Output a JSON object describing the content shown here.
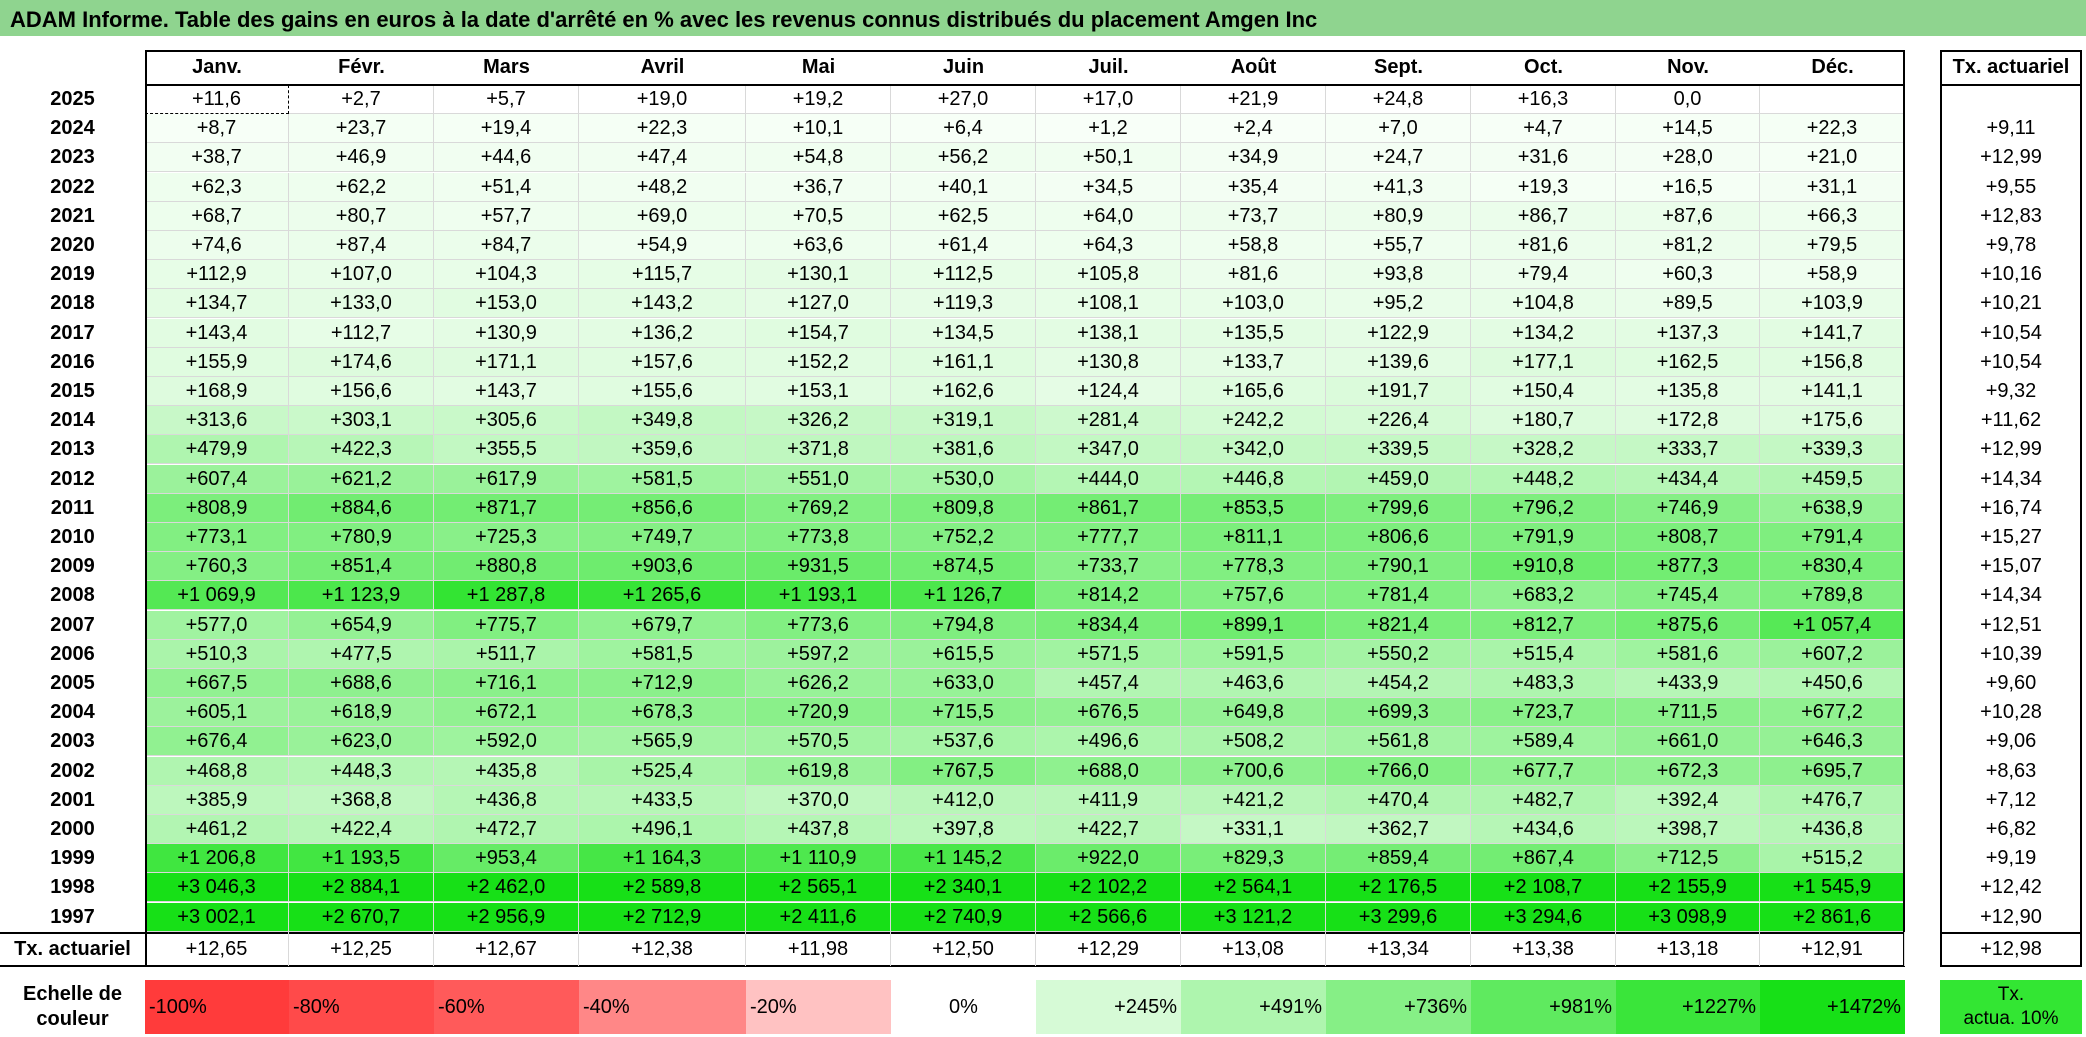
{
  "title": "ADAM Informe. Table des gains en euros à la date d'arrêté en % avec les revenus connus distribués du placement Amgen Inc",
  "months": [
    "Janv.",
    "Févr.",
    "Mars",
    "Avril",
    "Mai",
    "Juin",
    "Juil.",
    "Août",
    "Sept.",
    "Oct.",
    "Nov.",
    "Déc."
  ],
  "actuarial_header": "Tx. actuariel",
  "rows": [
    {
      "year": "2025",
      "values": [
        "+11,6",
        "+2,7",
        "+5,7",
        "+19,0",
        "+19,2",
        "+27,0",
        "+17,0",
        "+21,9",
        "+24,8",
        "+16,3",
        "0,0",
        ""
      ],
      "act": ""
    },
    {
      "year": "2024",
      "values": [
        "+8,7",
        "+23,7",
        "+19,4",
        "+22,3",
        "+10,1",
        "+6,4",
        "+1,2",
        "+2,4",
        "+7,0",
        "+4,7",
        "+14,5",
        "+22,3"
      ],
      "act": "+9,11"
    },
    {
      "year": "2023",
      "values": [
        "+38,7",
        "+46,9",
        "+44,6",
        "+47,4",
        "+54,8",
        "+56,2",
        "+50,1",
        "+34,9",
        "+24,7",
        "+31,6",
        "+28,0",
        "+21,0"
      ],
      "act": "+12,99"
    },
    {
      "year": "2022",
      "values": [
        "+62,3",
        "+62,2",
        "+51,4",
        "+48,2",
        "+36,7",
        "+40,1",
        "+34,5",
        "+35,4",
        "+41,3",
        "+19,3",
        "+16,5",
        "+31,1"
      ],
      "act": "+9,55"
    },
    {
      "year": "2021",
      "values": [
        "+68,7",
        "+80,7",
        "+57,7",
        "+69,0",
        "+70,5",
        "+62,5",
        "+64,0",
        "+73,7",
        "+80,9",
        "+86,7",
        "+87,6",
        "+66,3"
      ],
      "act": "+12,83"
    },
    {
      "year": "2020",
      "values": [
        "+74,6",
        "+87,4",
        "+84,7",
        "+54,9",
        "+63,6",
        "+61,4",
        "+64,3",
        "+58,8",
        "+55,7",
        "+81,6",
        "+81,2",
        "+79,5"
      ],
      "act": "+9,78"
    },
    {
      "year": "2019",
      "values": [
        "+112,9",
        "+107,0",
        "+104,3",
        "+115,7",
        "+130,1",
        "+112,5",
        "+105,8",
        "+81,6",
        "+93,8",
        "+79,4",
        "+60,3",
        "+58,9"
      ],
      "act": "+10,16"
    },
    {
      "year": "2018",
      "values": [
        "+134,7",
        "+133,0",
        "+153,0",
        "+143,2",
        "+127,0",
        "+119,3",
        "+108,1",
        "+103,0",
        "+95,2",
        "+104,8",
        "+89,5",
        "+103,9"
      ],
      "act": "+10,21"
    },
    {
      "year": "2017",
      "values": [
        "+143,4",
        "+112,7",
        "+130,9",
        "+136,2",
        "+154,7",
        "+134,5",
        "+138,1",
        "+135,5",
        "+122,9",
        "+134,2",
        "+137,3",
        "+141,7"
      ],
      "act": "+10,54"
    },
    {
      "year": "2016",
      "values": [
        "+155,9",
        "+174,6",
        "+171,1",
        "+157,6",
        "+152,2",
        "+161,1",
        "+130,8",
        "+133,7",
        "+139,6",
        "+177,1",
        "+162,5",
        "+156,8"
      ],
      "act": "+10,54"
    },
    {
      "year": "2015",
      "values": [
        "+168,9",
        "+156,6",
        "+143,7",
        "+155,6",
        "+153,1",
        "+162,6",
        "+124,4",
        "+165,6",
        "+191,7",
        "+150,4",
        "+135,8",
        "+141,1"
      ],
      "act": "+9,32"
    },
    {
      "year": "2014",
      "values": [
        "+313,6",
        "+303,1",
        "+305,6",
        "+349,8",
        "+326,2",
        "+319,1",
        "+281,4",
        "+242,2",
        "+226,4",
        "+180,7",
        "+172,8",
        "+175,6"
      ],
      "act": "+11,62"
    },
    {
      "year": "2013",
      "values": [
        "+479,9",
        "+422,3",
        "+355,5",
        "+359,6",
        "+371,8",
        "+381,6",
        "+347,0",
        "+342,0",
        "+339,5",
        "+328,2",
        "+333,7",
        "+339,3"
      ],
      "act": "+12,99"
    },
    {
      "year": "2012",
      "values": [
        "+607,4",
        "+621,2",
        "+617,9",
        "+581,5",
        "+551,0",
        "+530,0",
        "+444,0",
        "+446,8",
        "+459,0",
        "+448,2",
        "+434,4",
        "+459,5"
      ],
      "act": "+14,34"
    },
    {
      "year": "2011",
      "values": [
        "+808,9",
        "+884,6",
        "+871,7",
        "+856,6",
        "+769,2",
        "+809,8",
        "+861,7",
        "+853,5",
        "+799,6",
        "+796,2",
        "+746,9",
        "+638,9"
      ],
      "act": "+16,74"
    },
    {
      "year": "2010",
      "values": [
        "+773,1",
        "+780,9",
        "+725,3",
        "+749,7",
        "+773,8",
        "+752,2",
        "+777,7",
        "+811,1",
        "+806,6",
        "+791,9",
        "+808,7",
        "+791,4"
      ],
      "act": "+15,27"
    },
    {
      "year": "2009",
      "values": [
        "+760,3",
        "+851,4",
        "+880,8",
        "+903,6",
        "+931,5",
        "+874,5",
        "+733,7",
        "+778,3",
        "+790,1",
        "+910,8",
        "+877,3",
        "+830,4"
      ],
      "act": "+15,07"
    },
    {
      "year": "2008",
      "values": [
        "+1 069,9",
        "+1 123,9",
        "+1 287,8",
        "+1 265,6",
        "+1 193,1",
        "+1 126,7",
        "+814,2",
        "+757,6",
        "+781,4",
        "+683,2",
        "+745,4",
        "+789,8"
      ],
      "act": "+14,34"
    },
    {
      "year": "2007",
      "values": [
        "+577,0",
        "+654,9",
        "+775,7",
        "+679,7",
        "+773,6",
        "+794,8",
        "+834,4",
        "+899,1",
        "+821,4",
        "+812,7",
        "+875,6",
        "+1 057,4"
      ],
      "act": "+12,51"
    },
    {
      "year": "2006",
      "values": [
        "+510,3",
        "+477,5",
        "+511,7",
        "+581,5",
        "+597,2",
        "+615,5",
        "+571,5",
        "+591,5",
        "+550,2",
        "+515,4",
        "+581,6",
        "+607,2"
      ],
      "act": "+10,39"
    },
    {
      "year": "2005",
      "values": [
        "+667,5",
        "+688,6",
        "+716,1",
        "+712,9",
        "+626,2",
        "+633,0",
        "+457,4",
        "+463,6",
        "+454,2",
        "+483,3",
        "+433,9",
        "+450,6"
      ],
      "act": "+9,60"
    },
    {
      "year": "2004",
      "values": [
        "+605,1",
        "+618,9",
        "+672,1",
        "+678,3",
        "+720,9",
        "+715,5",
        "+676,5",
        "+649,8",
        "+699,3",
        "+723,7",
        "+711,5",
        "+677,2"
      ],
      "act": "+10,28"
    },
    {
      "year": "2003",
      "values": [
        "+676,4",
        "+623,0",
        "+592,0",
        "+565,9",
        "+570,5",
        "+537,6",
        "+496,6",
        "+508,2",
        "+561,8",
        "+589,4",
        "+661,0",
        "+646,3"
      ],
      "act": "+9,06"
    },
    {
      "year": "2002",
      "values": [
        "+468,8",
        "+448,3",
        "+435,8",
        "+525,4",
        "+619,8",
        "+767,5",
        "+688,0",
        "+700,6",
        "+766,0",
        "+677,7",
        "+672,3",
        "+695,7"
      ],
      "act": "+8,63"
    },
    {
      "year": "2001",
      "values": [
        "+385,9",
        "+368,8",
        "+436,8",
        "+433,5",
        "+370,0",
        "+412,0",
        "+411,9",
        "+421,2",
        "+470,4",
        "+482,7",
        "+392,4",
        "+476,7"
      ],
      "act": "+7,12"
    },
    {
      "year": "2000",
      "values": [
        "+461,2",
        "+422,4",
        "+472,7",
        "+496,1",
        "+437,8",
        "+397,8",
        "+422,7",
        "+331,1",
        "+362,7",
        "+434,6",
        "+398,7",
        "+436,8"
      ],
      "act": "+6,82"
    },
    {
      "year": "1999",
      "values": [
        "+1 206,8",
        "+1 193,5",
        "+953,4",
        "+1 164,3",
        "+1 110,9",
        "+1 145,2",
        "+922,0",
        "+829,3",
        "+859,4",
        "+867,4",
        "+712,5",
        "+515,2"
      ],
      "act": "+9,19"
    },
    {
      "year": "1998",
      "values": [
        "+3 046,3",
        "+2 884,1",
        "+2 462,0",
        "+2 589,8",
        "+2 565,1",
        "+2 340,1",
        "+2 102,2",
        "+2 564,1",
        "+2 176,5",
        "+2 108,7",
        "+2 155,9",
        "+1 545,9"
      ],
      "act": "+12,42"
    },
    {
      "year": "1997",
      "values": [
        "+3 002,1",
        "+2 670,7",
        "+2 956,9",
        "+2 712,9",
        "+2 411,6",
        "+2 740,9",
        "+2 566,6",
        "+3 121,2",
        "+3 299,6",
        "+3 294,6",
        "+3 098,9",
        "+2 861,6"
      ],
      "act": "+12,90"
    }
  ],
  "footer": {
    "label": "Tx. actuariel",
    "values": [
      "+12,65",
      "+12,25",
      "+12,67",
      "+12,38",
      "+11,98",
      "+12,50",
      "+12,29",
      "+13,08",
      "+13,34",
      "+13,38",
      "+13,18",
      "+12,91"
    ],
    "total": "+12,98"
  },
  "scale": {
    "label_line1": "Echelle de",
    "label_line2": "couleur",
    "items": [
      {
        "label": "-100%",
        "color": "#ff3b3b",
        "align": "left"
      },
      {
        "label": "-80%",
        "color": "#ff4a4a",
        "align": "left"
      },
      {
        "label": "-60%",
        "color": "#ff5a5a",
        "align": "left"
      },
      {
        "label": "-40%",
        "color": "#ff8787",
        "align": "left"
      },
      {
        "label": "-20%",
        "color": "#ffc2c2",
        "align": "left"
      },
      {
        "label": "0%",
        "color": "#ffffff",
        "align": "center"
      },
      {
        "label": "+245%",
        "color": "#d6fad6",
        "align": "right"
      },
      {
        "label": "+491%",
        "color": "#aef5ae",
        "align": "right"
      },
      {
        "label": "+736%",
        "color": "#86ef86",
        "align": "right"
      },
      {
        "label": "+981%",
        "color": "#5fea5f",
        "align": "right"
      },
      {
        "label": "+1227%",
        "color": "#3ae53a",
        "align": "right"
      },
      {
        "label": "+1472%",
        "color": "#17e017",
        "align": "right"
      }
    ],
    "act_line1": "Tx.",
    "act_line2": "actua. 10%",
    "act_color": "#33e633"
  }
}
